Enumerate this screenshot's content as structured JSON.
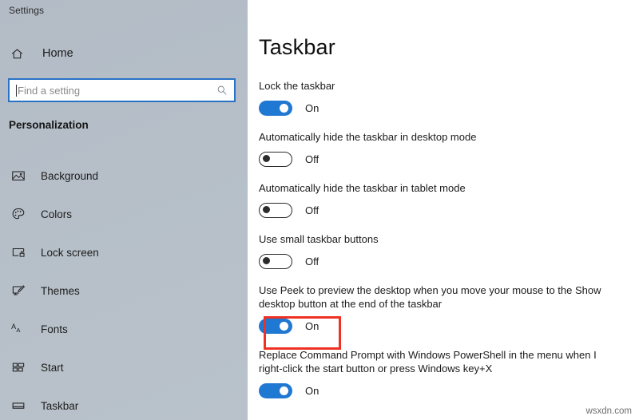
{
  "window": {
    "title": "Settings"
  },
  "sidebar": {
    "home": {
      "label": "Home",
      "icon": "home-icon"
    },
    "search": {
      "value": "",
      "placeholder": "Find a setting",
      "icon": "search-icon"
    },
    "section_header": "Personalization",
    "items": [
      {
        "label": "Background",
        "icon": "picture-icon"
      },
      {
        "label": "Colors",
        "icon": "palette-icon"
      },
      {
        "label": "Lock screen",
        "icon": "lock-screen-icon"
      },
      {
        "label": "Themes",
        "icon": "brush-monitor-icon"
      },
      {
        "label": "Fonts",
        "icon": "fonts-aa-icon"
      },
      {
        "label": "Start",
        "icon": "start-tiles-icon"
      },
      {
        "label": "Taskbar",
        "icon": "taskbar-icon"
      }
    ]
  },
  "main": {
    "page_title": "Taskbar",
    "settings": [
      {
        "label": "Lock the taskbar",
        "state": "On",
        "on": true
      },
      {
        "label": "Automatically hide the taskbar in desktop mode",
        "state": "Off",
        "on": false
      },
      {
        "label": "Automatically hide the taskbar in tablet mode",
        "state": "Off",
        "on": false
      },
      {
        "label": "Use small taskbar buttons",
        "state": "Off",
        "on": false
      },
      {
        "label": "Use Peek to preview the desktop when you move your mouse to the Show desktop button at the end of the taskbar",
        "state": "On",
        "on": true,
        "highlighted": true
      },
      {
        "label": "Replace Command Prompt with Windows PowerShell in the menu when I right-click the start button or press Windows key+X",
        "state": "On",
        "on": true
      }
    ]
  },
  "annotation": {
    "highlight_color": "#ef3124"
  },
  "watermark": {
    "text": "wsxdn.com"
  },
  "colors": {
    "accent": "#1f78d1",
    "sidebar_bg": "#b6bfc8",
    "search_focus_border": "#2a72c4"
  }
}
